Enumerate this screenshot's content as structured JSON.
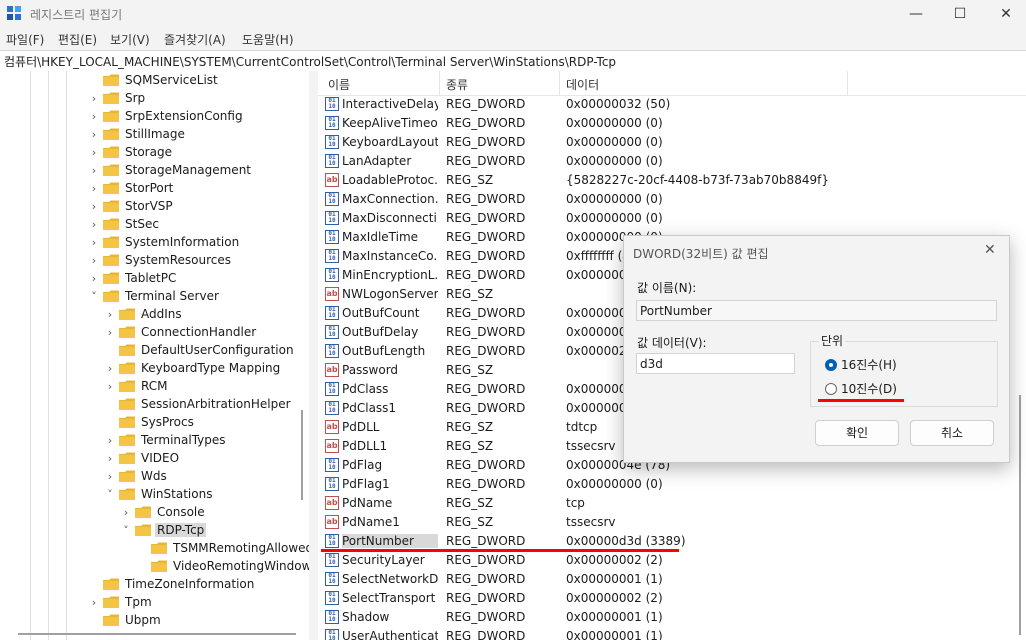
{
  "window": {
    "title": "레지스트리 편집기"
  },
  "menu": [
    "파일(F)",
    "편집(E)",
    "보기(V)",
    "즐겨찾기(A)",
    "도움말(H)"
  ],
  "address": "컴퓨터\\HKEY_LOCAL_MACHINE\\SYSTEM\\CurrentControlSet\\Control\\Terminal Server\\WinStations\\RDP-Tcp",
  "tree": {
    "items": [
      {
        "label": "SQMServiceList",
        "depth": 0,
        "expanded": false,
        "chevron": false,
        "selected": false
      },
      {
        "label": "Srp",
        "depth": 0,
        "expanded": false,
        "chevron": true,
        "selected": false
      },
      {
        "label": "SrpExtensionConfig",
        "depth": 0,
        "expanded": false,
        "chevron": true,
        "selected": false
      },
      {
        "label": "StillImage",
        "depth": 0,
        "expanded": false,
        "chevron": true,
        "selected": false
      },
      {
        "label": "Storage",
        "depth": 0,
        "expanded": false,
        "chevron": true,
        "selected": false
      },
      {
        "label": "StorageManagement",
        "depth": 0,
        "expanded": false,
        "chevron": true,
        "selected": false
      },
      {
        "label": "StorPort",
        "depth": 0,
        "expanded": false,
        "chevron": true,
        "selected": false
      },
      {
        "label": "StorVSP",
        "depth": 0,
        "expanded": false,
        "chevron": true,
        "selected": false
      },
      {
        "label": "StSec",
        "depth": 0,
        "expanded": false,
        "chevron": true,
        "selected": false
      },
      {
        "label": "SystemInformation",
        "depth": 0,
        "expanded": false,
        "chevron": true,
        "selected": false
      },
      {
        "label": "SystemResources",
        "depth": 0,
        "expanded": false,
        "chevron": true,
        "selected": false
      },
      {
        "label": "TabletPC",
        "depth": 0,
        "expanded": false,
        "chevron": true,
        "selected": false
      },
      {
        "label": "Terminal Server",
        "depth": 0,
        "expanded": true,
        "chevron": true,
        "selected": false
      },
      {
        "label": "AddIns",
        "depth": 1,
        "expanded": false,
        "chevron": true,
        "selected": false
      },
      {
        "label": "ConnectionHandler",
        "depth": 1,
        "expanded": false,
        "chevron": true,
        "selected": false
      },
      {
        "label": "DefaultUserConfiguration",
        "depth": 1,
        "expanded": false,
        "chevron": false,
        "selected": false
      },
      {
        "label": "KeyboardType Mapping",
        "depth": 1,
        "expanded": false,
        "chevron": true,
        "selected": false
      },
      {
        "label": "RCM",
        "depth": 1,
        "expanded": false,
        "chevron": true,
        "selected": false
      },
      {
        "label": "SessionArbitrationHelper",
        "depth": 1,
        "expanded": false,
        "chevron": false,
        "selected": false
      },
      {
        "label": "SysProcs",
        "depth": 1,
        "expanded": false,
        "chevron": false,
        "selected": false
      },
      {
        "label": "TerminalTypes",
        "depth": 1,
        "expanded": false,
        "chevron": true,
        "selected": false
      },
      {
        "label": "VIDEO",
        "depth": 1,
        "expanded": false,
        "chevron": true,
        "selected": false
      },
      {
        "label": "Wds",
        "depth": 1,
        "expanded": false,
        "chevron": true,
        "selected": false
      },
      {
        "label": "WinStations",
        "depth": 1,
        "expanded": true,
        "chevron": true,
        "selected": false
      },
      {
        "label": "Console",
        "depth": 2,
        "expanded": false,
        "chevron": true,
        "selected": false
      },
      {
        "label": "RDP-Tcp",
        "depth": 2,
        "expanded": true,
        "chevron": true,
        "selected": true
      },
      {
        "label": "TSMMRemotingAllowed",
        "depth": 3,
        "expanded": false,
        "chevron": false,
        "selected": false
      },
      {
        "label": "VideoRemotingWindow",
        "depth": 3,
        "expanded": false,
        "chevron": false,
        "selected": false
      },
      {
        "label": "TimeZoneInformation",
        "depth": 0,
        "expanded": false,
        "chevron": false,
        "selected": false
      },
      {
        "label": "Tpm",
        "depth": 0,
        "expanded": false,
        "chevron": true,
        "selected": false
      },
      {
        "label": "Ubpm",
        "depth": 0,
        "expanded": false,
        "chevron": false,
        "selected": false
      }
    ]
  },
  "values": {
    "headers": {
      "name": "이름",
      "type": "종류",
      "data": "데이터"
    },
    "rows": [
      {
        "name": "InteractiveDelay",
        "type": "REG_DWORD",
        "data": "0x00000032 (50)",
        "kind": "bin"
      },
      {
        "name": "KeepAliveTimeout",
        "type": "REG_DWORD",
        "data": "0x00000000 (0)",
        "kind": "bin"
      },
      {
        "name": "KeyboardLayout",
        "type": "REG_DWORD",
        "data": "0x00000000 (0)",
        "kind": "bin"
      },
      {
        "name": "LanAdapter",
        "type": "REG_DWORD",
        "data": "0x00000000 (0)",
        "kind": "bin"
      },
      {
        "name": "LoadableProtoc...",
        "type": "REG_SZ",
        "data": "{5828227c-20cf-4408-b73f-73ab70b8849f}",
        "kind": "sz"
      },
      {
        "name": "MaxConnection...",
        "type": "REG_DWORD",
        "data": "0x00000000 (0)",
        "kind": "bin"
      },
      {
        "name": "MaxDisconnecti...",
        "type": "REG_DWORD",
        "data": "0x00000000 (0)",
        "kind": "bin"
      },
      {
        "name": "MaxIdleTime",
        "type": "REG_DWORD",
        "data": "0x00000000 (0)",
        "kind": "bin"
      },
      {
        "name": "MaxInstanceCo...",
        "type": "REG_DWORD",
        "data": "0xffffffff (4",
        "kind": "bin"
      },
      {
        "name": "MinEncryptionL...",
        "type": "REG_DWORD",
        "data": "0x0000000",
        "kind": "bin"
      },
      {
        "name": "NWLogonServer",
        "type": "REG_SZ",
        "data": "",
        "kind": "sz"
      },
      {
        "name": "OutBufCount",
        "type": "REG_DWORD",
        "data": "0x0000000",
        "kind": "bin"
      },
      {
        "name": "OutBufDelay",
        "type": "REG_DWORD",
        "data": "0x0000006",
        "kind": "bin"
      },
      {
        "name": "OutBufLength",
        "type": "REG_DWORD",
        "data": "0x0000021",
        "kind": "bin"
      },
      {
        "name": "Password",
        "type": "REG_SZ",
        "data": "",
        "kind": "sz"
      },
      {
        "name": "PdClass",
        "type": "REG_DWORD",
        "data": "0x0000000",
        "kind": "bin"
      },
      {
        "name": "PdClass1",
        "type": "REG_DWORD",
        "data": "0x0000000",
        "kind": "bin"
      },
      {
        "name": "PdDLL",
        "type": "REG_SZ",
        "data": "tdtcp",
        "kind": "sz"
      },
      {
        "name": "PdDLL1",
        "type": "REG_SZ",
        "data": "tssecsrv",
        "kind": "sz"
      },
      {
        "name": "PdFlag",
        "type": "REG_DWORD",
        "data": "0x0000004e (78)",
        "kind": "bin"
      },
      {
        "name": "PdFlag1",
        "type": "REG_DWORD",
        "data": "0x00000000 (0)",
        "kind": "bin"
      },
      {
        "name": "PdName",
        "type": "REG_SZ",
        "data": "tcp",
        "kind": "sz"
      },
      {
        "name": "PdName1",
        "type": "REG_SZ",
        "data": "tssecsrv",
        "kind": "sz"
      },
      {
        "name": "PortNumber",
        "type": "REG_DWORD",
        "data": "0x00000d3d (3389)",
        "kind": "bin",
        "selected": true
      },
      {
        "name": "SecurityLayer",
        "type": "REG_DWORD",
        "data": "0x00000002 (2)",
        "kind": "bin"
      },
      {
        "name": "SelectNetworkD...",
        "type": "REG_DWORD",
        "data": "0x00000001 (1)",
        "kind": "bin"
      },
      {
        "name": "SelectTransport",
        "type": "REG_DWORD",
        "data": "0x00000002 (2)",
        "kind": "bin"
      },
      {
        "name": "Shadow",
        "type": "REG_DWORD",
        "data": "0x00000001 (1)",
        "kind": "bin"
      },
      {
        "name": "UserAuthenticat...",
        "type": "REG_DWORD",
        "data": "0x00000001 (1)",
        "kind": "bin"
      }
    ]
  },
  "dialog": {
    "title": "DWORD(32비트) 값 편집",
    "name_label": "값 이름(N):",
    "name_value": "PortNumber",
    "data_label": "값 데이터(V):",
    "data_value": "d3d",
    "base_label": "단위",
    "hex_label": "16진수(H)",
    "dec_label": "10진수(D)",
    "hex_selected": true,
    "ok_label": "확인",
    "cancel_label": "취소"
  },
  "colors": {
    "annotation_red": "#ff0000",
    "folder_yellow": "#f4c542",
    "accent": "#005fb8"
  }
}
